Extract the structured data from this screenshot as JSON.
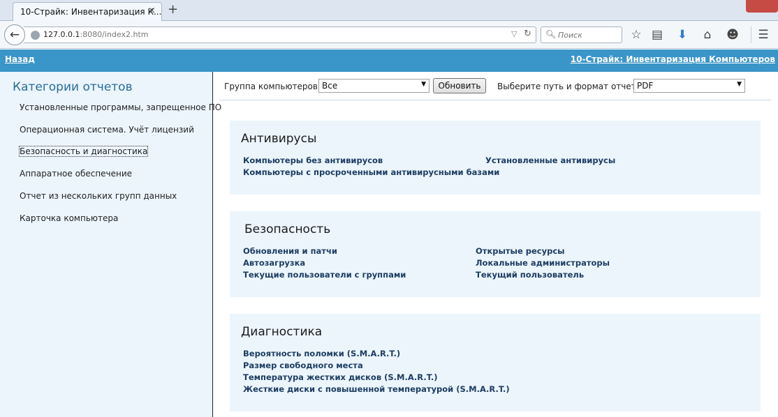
{
  "browser": {
    "tab_title": "10-Страйк: Инвентаризация К...",
    "tab_close": "×",
    "new_tab": "+",
    "url_host": "127.0.0.1",
    "url_rest": ":8080/index2.htm",
    "search_placeholder": "Поиск"
  },
  "header": {
    "back_label": "Назад",
    "title": "10-Страйк: Инвентаризация Компьютеров"
  },
  "sidebar": {
    "title": "Категории отчетов",
    "items": [
      {
        "label": "Установленные программы, запрещенное ПО"
      },
      {
        "label": "Операционная система. Учёт лицензий"
      },
      {
        "label": "Безопасность и диагностика",
        "active": true
      },
      {
        "label": "Аппаратное обеспечение"
      },
      {
        "label": "Отчет из нескольких групп данных"
      },
      {
        "label": "Карточка компьютера"
      }
    ]
  },
  "toolbar": {
    "group_label": "Группа компьютеров:",
    "group_value": "Все",
    "refresh_label": "Обновить",
    "format_label": "Выберите путь и формат отчета",
    "format_value": "PDF"
  },
  "sections": [
    {
      "title": "Антивирусы",
      "links": [
        "Компьютеры без антивирусов",
        "Компьютеры с просроченными антивирусными базами",
        "Установленные антивирусы"
      ]
    },
    {
      "title": "Безопасность",
      "links": [
        "Обновления и патчи",
        "Автозагрузка",
        "Текущие пользователи с группами",
        "Открытые ресурсы",
        "Локальные администраторы",
        "Текущий пользователь"
      ]
    },
    {
      "title": "Диагностика",
      "links": [
        "Вероятность поломки (S.M.A.R.T.)",
        "Размер свободного места",
        "Температура жестких дисков (S.M.A.R.T.)",
        "Жесткие диски с повышенной температурой (S.M.A.R.T.)"
      ]
    }
  ],
  "colors": {
    "header_bg": "#3a95c9",
    "panel_bg": "#ecf5fc",
    "link": "#1d3d63",
    "sidebar_title": "#2a6d9c"
  }
}
